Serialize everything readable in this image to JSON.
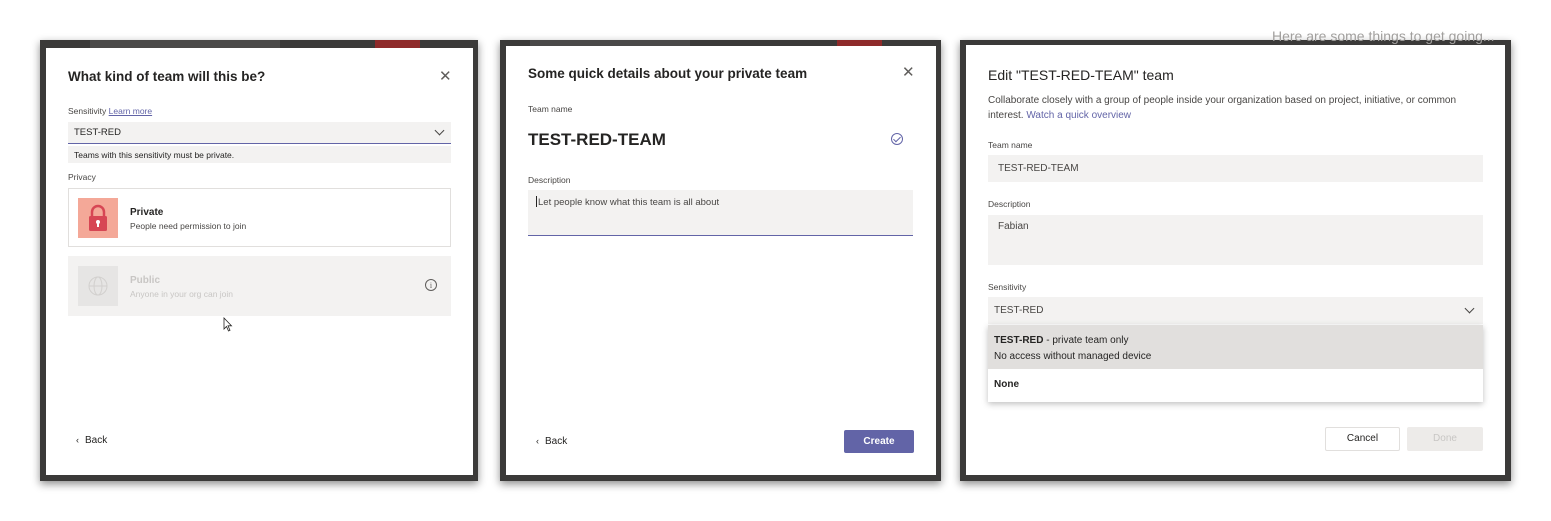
{
  "dialog1": {
    "title": "What kind of team will this be?",
    "close_icon": "close-icon",
    "sensitivity_label": "Sensitivity",
    "learn_more": "Learn more",
    "sensitivity_value": "TEST-RED",
    "sensitivity_note": "Teams with this sensitivity must be private.",
    "privacy_label": "Privacy",
    "private_title": "Private",
    "private_sub": "People need permission to join",
    "public_title": "Public",
    "public_sub": "Anyone in your org can join",
    "back": "Back"
  },
  "dialog2": {
    "title": "Some quick details about your private team",
    "team_name_label": "Team name",
    "team_name_value": "TEST-RED-TEAM",
    "description_label": "Description",
    "description_placeholder": "Let people know what this team is all about",
    "back": "Back",
    "create": "Create"
  },
  "dialog3": {
    "title": "Edit \"TEST-RED-TEAM\" team",
    "desc": "Collaborate closely with a group of people inside your organization based on project, initiative, or common interest.",
    "watch_link": "Watch a quick overview",
    "team_name_label": "Team name",
    "team_name_value": "TEST-RED-TEAM",
    "description_label": "Description",
    "description_value": "Fabian",
    "sensitivity_label": "Sensitivity",
    "sensitivity_value": "TEST-RED",
    "options": [
      {
        "name": "TEST-RED",
        "suffix": " - private team only",
        "sub": "No access without managed device"
      },
      {
        "name": "None"
      }
    ],
    "cancel": "Cancel",
    "done": "Done",
    "background_text": "Here are some things to get going..."
  },
  "colors": {
    "accent": "#6264a7",
    "private_icon_bg": "#f4a898",
    "lock": "#d74654",
    "frame": "#3b3a39",
    "backdrop_red": "#8e2a2a"
  }
}
